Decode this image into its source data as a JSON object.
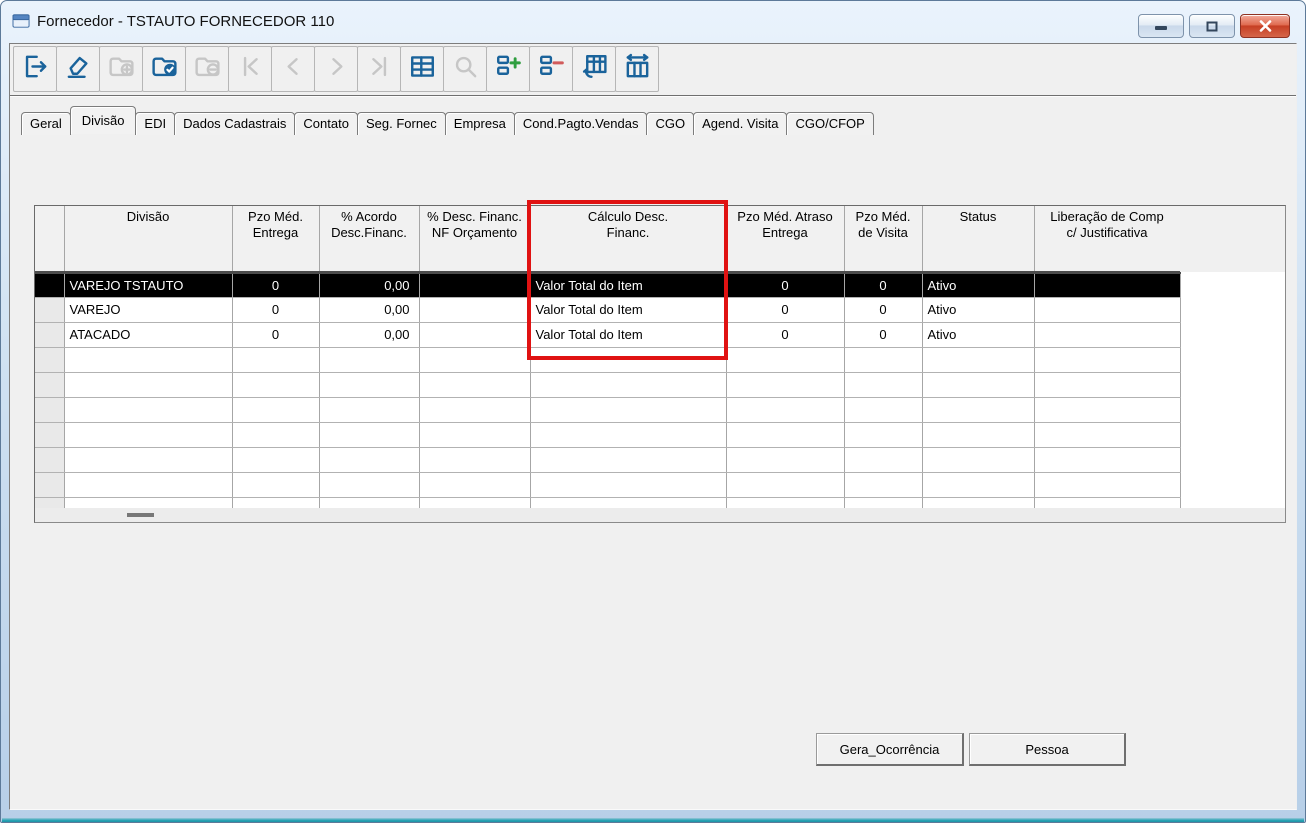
{
  "window": {
    "title": "Fornecedor - TSTAUTO FORNECEDOR 110"
  },
  "toolbar": {
    "buttons": [
      {
        "name": "exit",
        "enabled": true
      },
      {
        "name": "clear",
        "enabled": true
      },
      {
        "name": "insert",
        "enabled": false
      },
      {
        "name": "confirm",
        "enabled": true
      },
      {
        "name": "delete",
        "enabled": false
      },
      {
        "name": "first-record",
        "enabled": false
      },
      {
        "name": "prior-record",
        "enabled": false
      },
      {
        "name": "next-record",
        "enabled": false
      },
      {
        "name": "last-record",
        "enabled": false
      },
      {
        "name": "grid-view",
        "enabled": true
      },
      {
        "name": "search",
        "enabled": false
      },
      {
        "name": "add-row",
        "enabled": true
      },
      {
        "name": "remove-row",
        "enabled": true
      },
      {
        "name": "refresh-grid",
        "enabled": true
      },
      {
        "name": "fit-columns",
        "enabled": true
      }
    ]
  },
  "tabs": [
    {
      "label": "Geral",
      "active": false
    },
    {
      "label": "Divisão",
      "active": true
    },
    {
      "label": "EDI",
      "active": false
    },
    {
      "label": "Dados Cadastrais",
      "active": false
    },
    {
      "label": "Contato",
      "active": false
    },
    {
      "label": "Seg. Fornec",
      "active": false
    },
    {
      "label": "Empresa",
      "active": false
    },
    {
      "label": "Cond.Pagto.Vendas",
      "active": false
    },
    {
      "label": "CGO",
      "active": false
    },
    {
      "label": "Agend. Visita",
      "active": false
    },
    {
      "label": "CGO/CFOP",
      "active": false
    }
  ],
  "grid": {
    "columns": [
      "Divisão",
      "Pzo Méd.\nEntrega",
      "% Acordo\nDesc.Financ.",
      "% Desc. Financ.\nNF Orçamento",
      "Cálculo Desc.\nFinanc.",
      "Pzo Méd. Atraso\nEntrega",
      "Pzo Méd.\nde Visita",
      "Status",
      "Liberação de Comp\nc/ Justificativa"
    ],
    "rows": [
      {
        "selected": true,
        "cells": [
          "VAREJO TSTAUTO",
          "0",
          "0,00",
          "",
          "Valor Total do Item",
          "0",
          "0",
          "Ativo",
          ""
        ]
      },
      {
        "selected": false,
        "cells": [
          "VAREJO",
          "0",
          "0,00",
          "",
          "Valor Total do Item",
          "0",
          "0",
          "Ativo",
          ""
        ]
      },
      {
        "selected": false,
        "cells": [
          "ATACADO",
          "0",
          "0,00",
          "",
          "Valor Total do Item",
          "0",
          "0",
          "Ativo",
          ""
        ]
      }
    ],
    "empty_rows": 6,
    "highlighted_column": "Cálculo Desc. Financ.",
    "highlight_color": "#e01212"
  },
  "footer": {
    "buttons": [
      {
        "label": "Gera_Ocorrência"
      },
      {
        "label": "Pessoa"
      }
    ]
  }
}
